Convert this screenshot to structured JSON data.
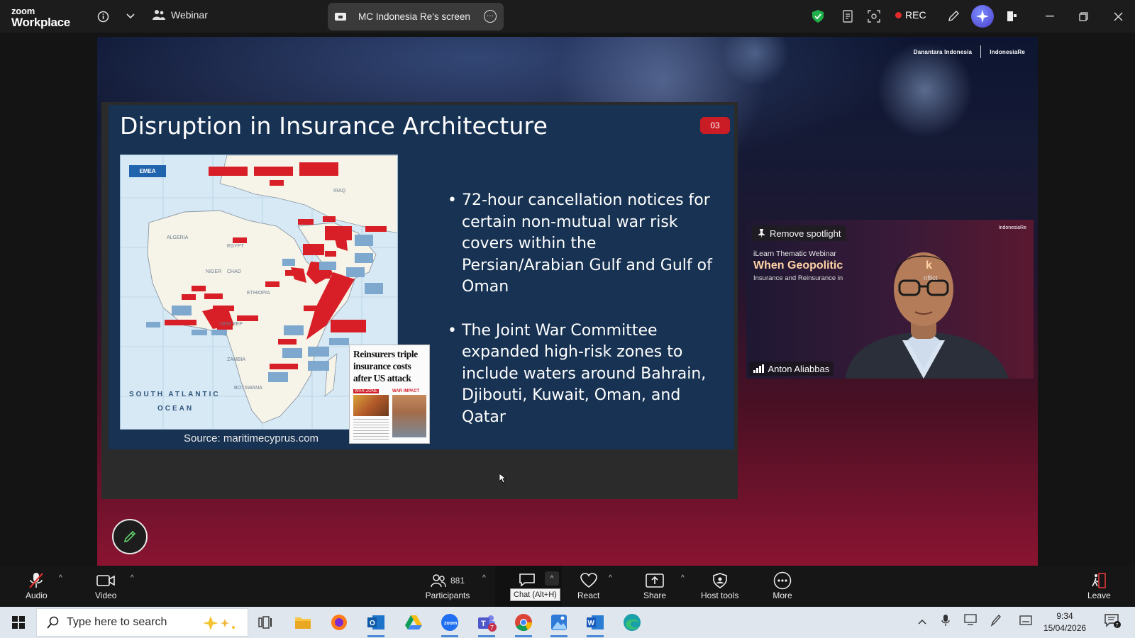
{
  "topbar": {
    "logo_line1": "zoom",
    "logo_line2": "Workplace",
    "webinar_label": "Webinar",
    "screen_tab_label": "MC Indonesia Re's screen",
    "rec_label": "REC"
  },
  "slide": {
    "title": "Disruption in Insurance Architecture",
    "number": "03",
    "map_region": "EMEA",
    "map_ocean_1": "SOUTH ATLANTIC",
    "map_ocean_2": "OCEAN",
    "source": "Source: maritimecyprus.com",
    "news_headline": "Reinsurers triple insurance costs after US attack",
    "news_label_1": "WAR ZONE",
    "news_label_2": "WAR IMPACT",
    "bullets": [
      "72-hour cancellation notices for certain non-mutual war risk covers within the Persian/Arabian Gulf and Gulf of Oman",
      "The Joint War Committee expanded high-risk zones to include waters around Bahrain, Djibouti, Kuwait, Oman, and Qatar"
    ],
    "brand_1": "Danantara Indonesia",
    "brand_2": "IndonesiaRe"
  },
  "video": {
    "spotlight_label": "Remove spotlight",
    "participant_name": "Anton Aliabbas",
    "bg_line1": "iLearn Thematic Webinar",
    "bg_line2": "When Geopolitic",
    "bg_line2b": "k",
    "bg_line3": "Insurance and Reinsurance in",
    "bg_line3b": "nflict"
  },
  "controls": {
    "audio": "Audio",
    "video": "Video",
    "participants": "Participants",
    "participants_count": "881",
    "chat_tooltip": "Chat (Alt+H)",
    "react": "React",
    "share": "Share",
    "host_tools": "Host tools",
    "more": "More",
    "leave": "Leave"
  },
  "taskbar": {
    "search_placeholder": "Type here to search",
    "time": "9:34",
    "date": "15/04/2026",
    "teams_badge": "7",
    "notif_count": "7"
  }
}
